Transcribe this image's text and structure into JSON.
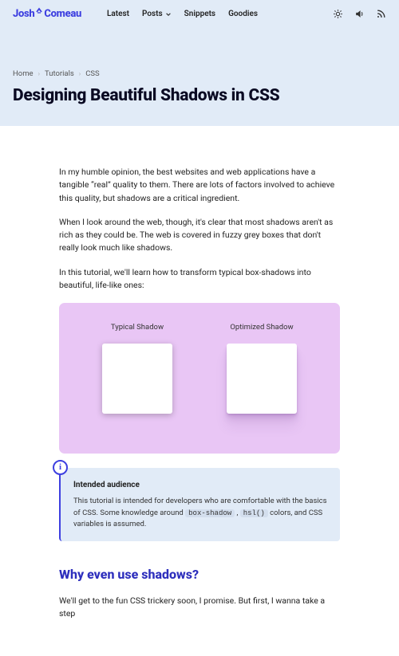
{
  "logo": {
    "first": "Josh",
    "last": "Comeau"
  },
  "nav": {
    "items": [
      "Latest",
      "Posts",
      "Snippets",
      "Goodies"
    ]
  },
  "breadcrumb": [
    "Home",
    "Tutorials",
    "CSS"
  ],
  "title": "Designing Beautiful Shadows in CSS",
  "paragraphs": {
    "p1": "In my humble opinion, the best websites and web applications have a tangible “real” quality to them. There are lots of factors involved to achieve this quality, but shadows are a critical ingredient.",
    "p2": "When I look around the web, though, it's clear that most shadows aren't as rich as they could be. The web is covered in fuzzy grey boxes that don't really look much like shadows.",
    "p3": "In this tutorial, we'll learn how to transform typical box-shadows into beautiful, life-like ones:"
  },
  "demo": {
    "typical_label": "Typical Shadow",
    "optimized_label": "Optimized Shadow"
  },
  "aside": {
    "title": "Intended audience",
    "body_pre": "This tutorial is intended for developers who are comfortable with the basics of CSS. Some knowledge around ",
    "code1": "box-shadow",
    "mid": " , ",
    "code2": "hsl()",
    "body_post": " colors, and CSS variables is assumed."
  },
  "h2": "Why even use shadows?",
  "closing": "We'll get to the fun CSS trickery soon, I promise. But first, I wanna take a step"
}
